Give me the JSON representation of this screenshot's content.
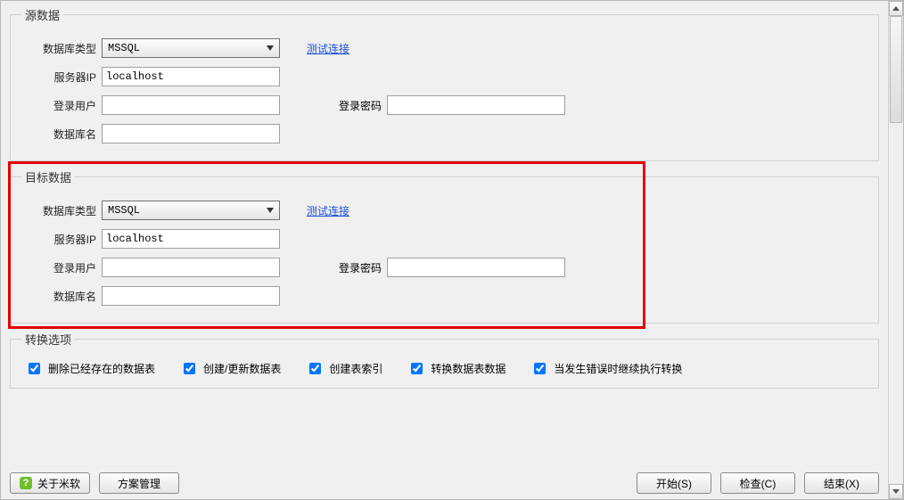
{
  "source": {
    "legend": "源数据",
    "db_type_label": "数据库类型",
    "db_type_value": "MSSQL",
    "test_link": "测试连接",
    "server_label": "服务器IP",
    "server_value": "localhost",
    "user_label": "登录用户",
    "user_value": "",
    "pwd_label": "登录密码",
    "pwd_value": "",
    "dbname_label": "数据库名",
    "dbname_value": ""
  },
  "target": {
    "legend": "目标数据",
    "db_type_label": "数据库类型",
    "db_type_value": "MSSQL",
    "test_link": "测试连接",
    "server_label": "服务器IP",
    "server_value": "localhost",
    "user_label": "登录用户",
    "user_value": "",
    "pwd_label": "登录密码",
    "pwd_value": "",
    "dbname_label": "数据库名",
    "dbname_value": ""
  },
  "options": {
    "legend": "转换选项",
    "drop_existing": "删除已经存在的数据表",
    "create_update": "创建/更新数据表",
    "create_index": "创建表索引",
    "transfer_data": "转换数据表数据",
    "continue_on_error": "当发生错误时继续执行转换"
  },
  "footer": {
    "about": "关于米软",
    "scheme": "方案管理",
    "start": "开始(S)",
    "check": "检查(C)",
    "end": "结束(X)"
  }
}
